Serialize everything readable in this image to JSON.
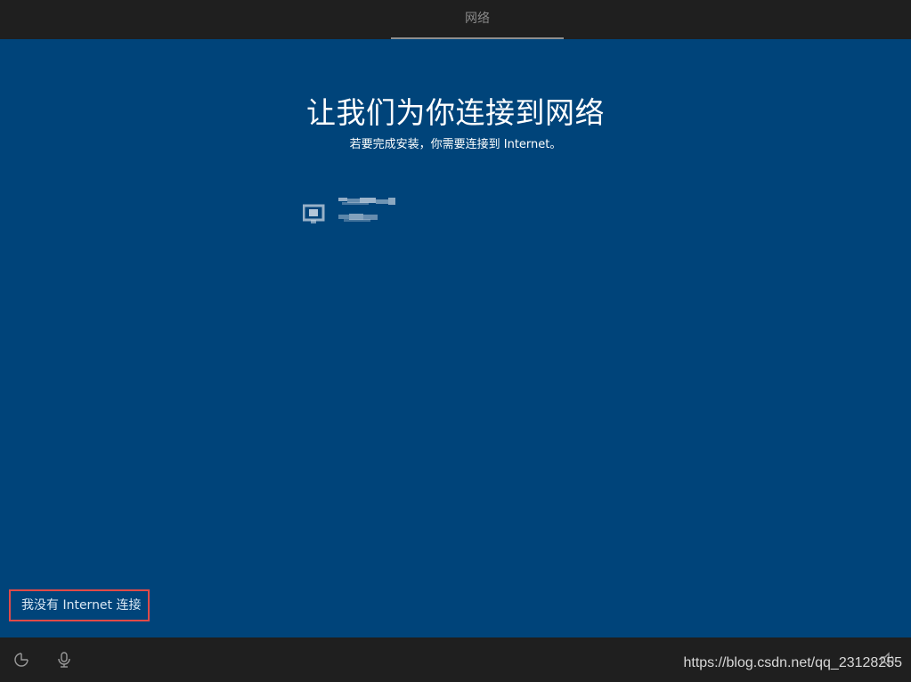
{
  "window": {
    "step_label": "网络"
  },
  "main": {
    "title": "让我们为你连接到网络",
    "subtitle": "若要完成安装，你需要连接到 Internet。",
    "network": {
      "icon": "ethernet-icon"
    },
    "no_internet_link": "我没有 Internet 连接"
  },
  "bottombar": {
    "ease_of_access_icon": "ease-of-access-icon",
    "microphone_icon": "microphone-icon",
    "volume_icon": "volume-icon"
  },
  "watermark": "https://blog.csdn.net/qq_23128255",
  "colors": {
    "background_blue": "#00447a",
    "bar_dark": "#1f1f1f",
    "highlight_border": "#e04a48"
  }
}
